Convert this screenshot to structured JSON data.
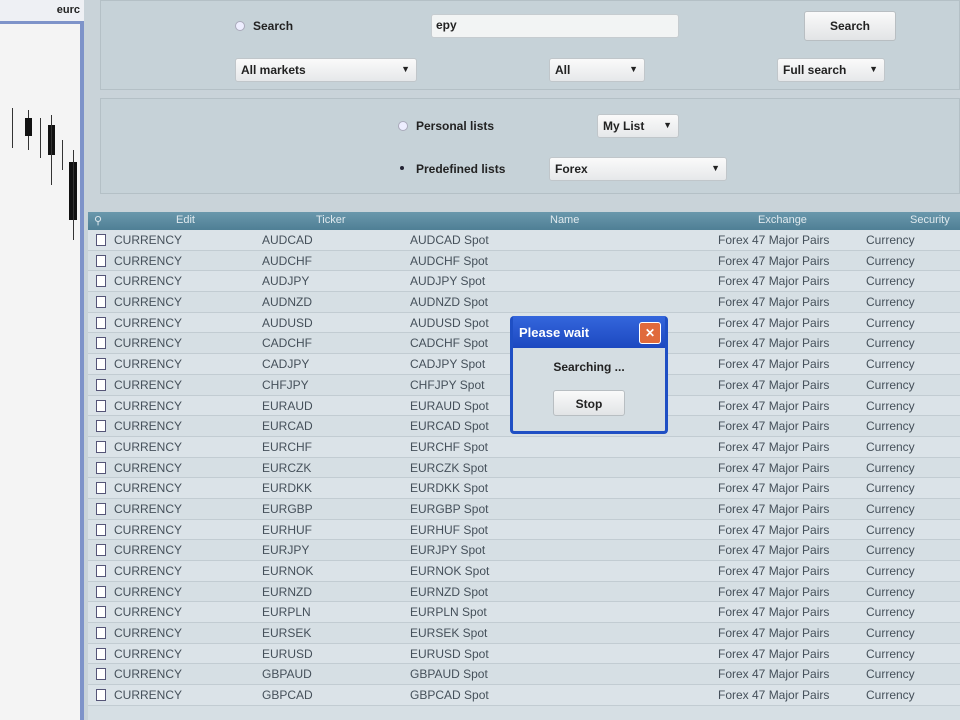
{
  "left_panel": {
    "tab_label": "eurc"
  },
  "search": {
    "radio_label": "Search",
    "query": "epy",
    "button": "Search",
    "markets": "All markets",
    "type": "All",
    "mode": "Full search"
  },
  "lists": {
    "personal_label": "Personal lists",
    "personal_value": "My List",
    "predefined_label": "Predefined lists",
    "predefined_value": "Forex"
  },
  "table": {
    "headers": [
      "Edit",
      "Ticker",
      "",
      "Name",
      "Exchange",
      "Security"
    ],
    "rows": [
      [
        "CURRENCY",
        "AUDCAD",
        "AUDCAD Spot",
        "Forex 47 Major Pairs",
        "Currency"
      ],
      [
        "CURRENCY",
        "AUDCHF",
        "AUDCHF Spot",
        "Forex 47 Major Pairs",
        "Currency"
      ],
      [
        "CURRENCY",
        "AUDJPY",
        "AUDJPY Spot",
        "Forex 47 Major Pairs",
        "Currency"
      ],
      [
        "CURRENCY",
        "AUDNZD",
        "AUDNZD Spot",
        "Forex 47 Major Pairs",
        "Currency"
      ],
      [
        "CURRENCY",
        "AUDUSD",
        "AUDUSD Spot",
        "Forex 47 Major Pairs",
        "Currency"
      ],
      [
        "CURRENCY",
        "CADCHF",
        "CADCHF Spot",
        "Forex 47 Major Pairs",
        "Currency"
      ],
      [
        "CURRENCY",
        "CADJPY",
        "CADJPY Spot",
        "Forex 47 Major Pairs",
        "Currency"
      ],
      [
        "CURRENCY",
        "CHFJPY",
        "CHFJPY Spot",
        "Forex 47 Major Pairs",
        "Currency"
      ],
      [
        "CURRENCY",
        "EURAUD",
        "EURAUD Spot",
        "Forex 47 Major Pairs",
        "Currency"
      ],
      [
        "CURRENCY",
        "EURCAD",
        "EURCAD Spot",
        "Forex 47 Major Pairs",
        "Currency"
      ],
      [
        "CURRENCY",
        "EURCHF",
        "EURCHF Spot",
        "Forex 47 Major Pairs",
        "Currency"
      ],
      [
        "CURRENCY",
        "EURCZK",
        "EURCZK Spot",
        "Forex 47 Major Pairs",
        "Currency"
      ],
      [
        "CURRENCY",
        "EURDKK",
        "EURDKK Spot",
        "Forex 47 Major Pairs",
        "Currency"
      ],
      [
        "CURRENCY",
        "EURGBP",
        "EURGBP Spot",
        "Forex 47 Major Pairs",
        "Currency"
      ],
      [
        "CURRENCY",
        "EURHUF",
        "EURHUF Spot",
        "Forex 47 Major Pairs",
        "Currency"
      ],
      [
        "CURRENCY",
        "EURJPY",
        "EURJPY Spot",
        "Forex 47 Major Pairs",
        "Currency"
      ],
      [
        "CURRENCY",
        "EURNOK",
        "EURNOK Spot",
        "Forex 47 Major Pairs",
        "Currency"
      ],
      [
        "CURRENCY",
        "EURNZD",
        "EURNZD Spot",
        "Forex 47 Major Pairs",
        "Currency"
      ],
      [
        "CURRENCY",
        "EURPLN",
        "EURPLN Spot",
        "Forex 47 Major Pairs",
        "Currency"
      ],
      [
        "CURRENCY",
        "EURSEK",
        "EURSEK Spot",
        "Forex 47 Major Pairs",
        "Currency"
      ],
      [
        "CURRENCY",
        "EURUSD",
        "EURUSD Spot",
        "Forex 47 Major Pairs",
        "Currency"
      ],
      [
        "CURRENCY",
        "GBPAUD",
        "GBPAUD Spot",
        "Forex 47 Major Pairs",
        "Currency"
      ],
      [
        "CURRENCY",
        "GBPCAD",
        "GBPCAD Spot",
        "Forex 47 Major Pairs",
        "Currency"
      ]
    ]
  },
  "dialog": {
    "title": "Please wait",
    "message": "Searching ...",
    "stop": "Stop"
  }
}
